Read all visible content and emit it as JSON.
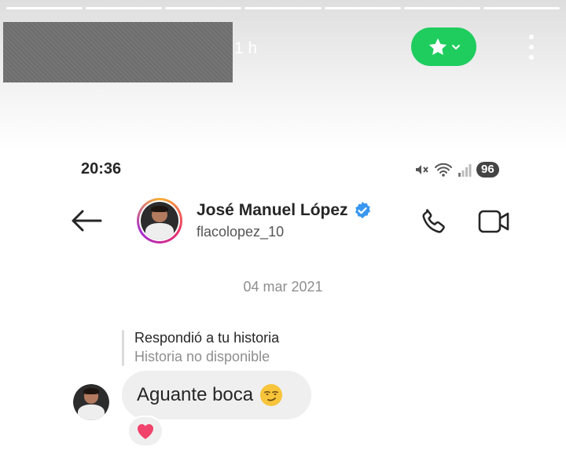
{
  "story": {
    "progress_segments": 7,
    "time_ago": "1 h"
  },
  "status_bar": {
    "time": "20:36",
    "battery": "96"
  },
  "header": {
    "contact_name": "José Manuel López",
    "username": "flacolopez_10"
  },
  "thread": {
    "date_separator": "04 mar 2021",
    "reply_title": "Respondió a tu historia",
    "reply_subtitle": "Historia no disponible",
    "message_text": "Aguante boca",
    "reaction": "❤️"
  },
  "colors": {
    "close_friends_green": "#1fcd5e",
    "verified_blue": "#3897f0",
    "text_primary": "#262626",
    "text_secondary": "#8e8e8e",
    "bubble_bg": "#efefef"
  },
  "icons": [
    "star-icon",
    "chevron-down-icon",
    "more-vertical-icon",
    "mute-icon",
    "wifi-icon",
    "signal-icon",
    "back-arrow-icon",
    "verified-badge-icon",
    "phone-icon",
    "video-call-icon",
    "smirk-emoji-icon",
    "heart-icon"
  ]
}
